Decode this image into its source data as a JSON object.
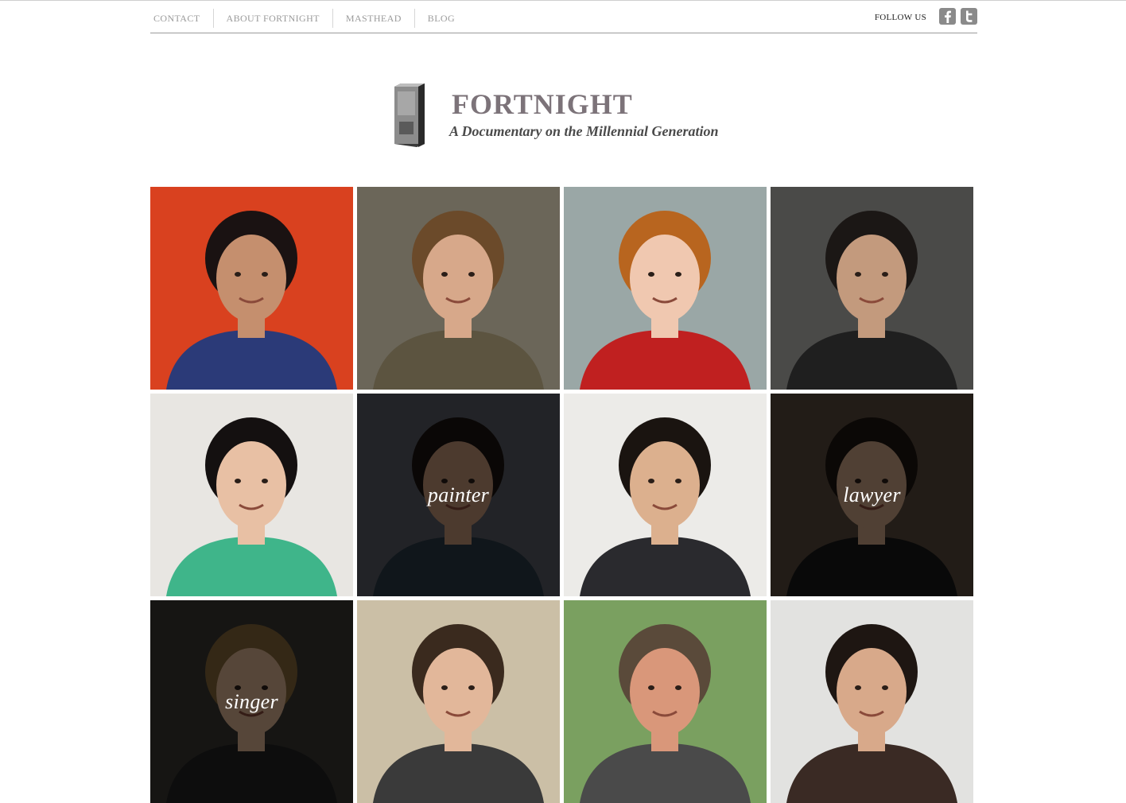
{
  "nav": {
    "links": [
      "CONTACT",
      "ABOUT FORTNIGHT",
      "MASTHEAD",
      "BLOG"
    ],
    "follow_label": "FOLLOW US",
    "social": [
      "facebook-icon",
      "twitter-icon"
    ]
  },
  "brand": {
    "title": "FORTNIGHT",
    "subtitle": "A Documentary on the Millennial Generation"
  },
  "colors": {
    "nav_text": "#9a9a9a",
    "title": "#7c7379",
    "subtitle": "#4a4a4a",
    "overlay": "rgba(0,0,0,0.62)"
  },
  "grid": {
    "tiles": [
      {
        "role": "",
        "bg": "#d9411f",
        "skin": "#c58f6e",
        "hair": "#1a1212",
        "shirt": "#2b3a78"
      },
      {
        "role": "",
        "bg": "#6b6659",
        "skin": "#d7a88a",
        "hair": "#6b4a2a",
        "shirt": "#5c5440"
      },
      {
        "role": "",
        "bg": "#9aa7a6",
        "skin": "#f0c8b0",
        "hair": "#b8651f",
        "shirt": "#c02020"
      },
      {
        "role": "",
        "bg": "#4a4a48",
        "skin": "#c39a7d",
        "hair": "#1b1715",
        "shirt": "#1f1f1f"
      },
      {
        "role": "",
        "bg": "#e8e6e2",
        "skin": "#e8c0a4",
        "hair": "#141010",
        "shirt": "#3fb58a"
      },
      {
        "role": "painter",
        "bg": "#5a5e66",
        "skin": "#c8987a",
        "hair": "#1b1410",
        "shirt": "#2a3a48"
      },
      {
        "role": "",
        "bg": "#ecebe8",
        "skin": "#dcb08e",
        "hair": "#1a1410",
        "shirt": "#2a2a2e"
      },
      {
        "role": "lawyer",
        "bg": "#5a4a3e",
        "skin": "#d2a888",
        "hair": "#1f1510",
        "shirt": "#1a1a1a"
      },
      {
        "role": "singer",
        "bg": "#3a3834",
        "skin": "#e3b895",
        "hair": "#8a6a3a",
        "shirt": "#222222"
      },
      {
        "role": "",
        "bg": "#cbbfa6",
        "skin": "#e2b79a",
        "hair": "#3a2a1e",
        "shirt": "#3a3a3a"
      },
      {
        "role": "",
        "bg": "#7aa060",
        "skin": "#d9977a",
        "hair": "#5a4a3a",
        "shirt": "#4a4a4a"
      },
      {
        "role": "",
        "bg": "#e2e2e0",
        "skin": "#d8a98a",
        "hair": "#1e1612",
        "shirt": "#3a2a24"
      }
    ]
  }
}
